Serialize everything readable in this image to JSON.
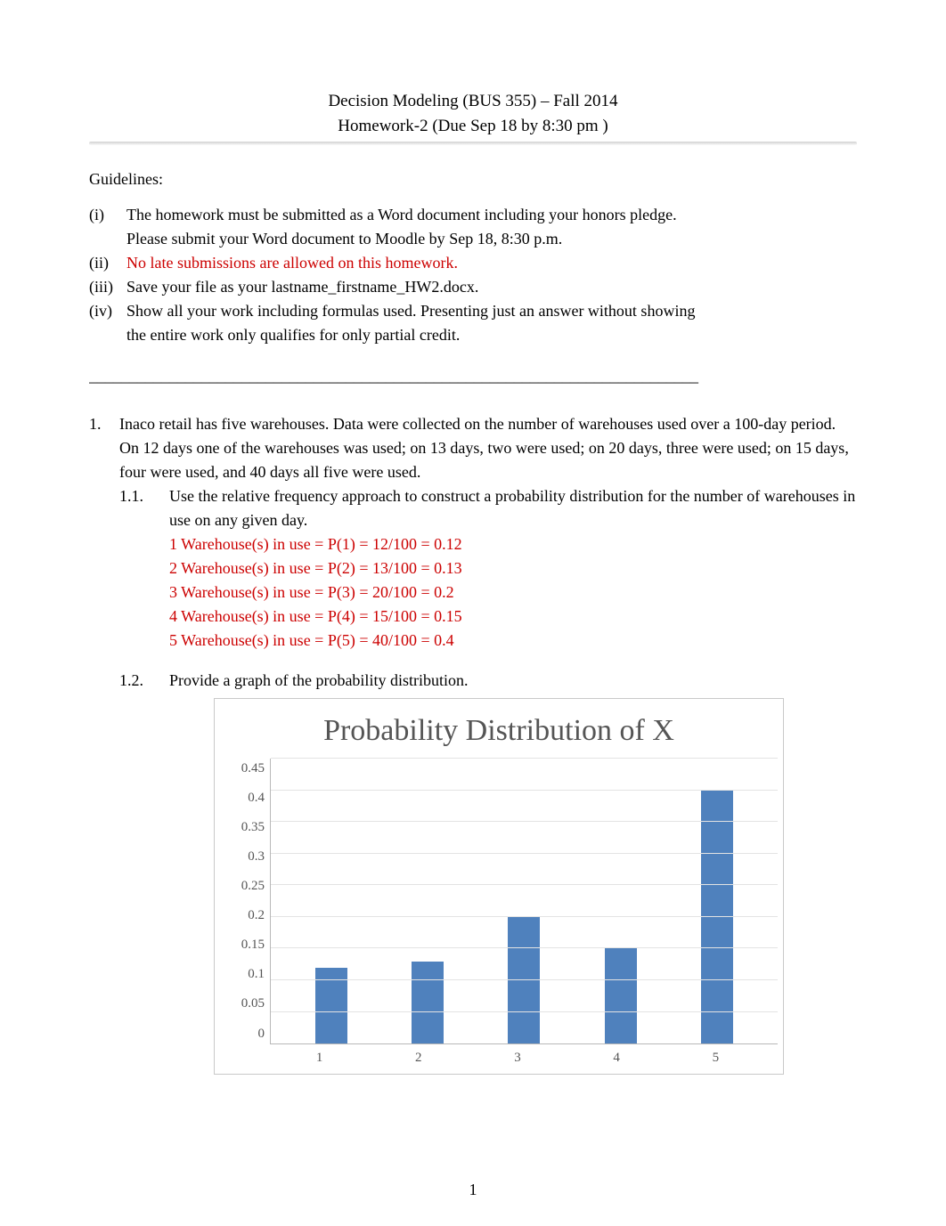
{
  "header": {
    "line1_a": "Decision Modeling (BUS 355)",
    "line1_b": "    – Fall 2014",
    "line2_a": "Homework-2 (",
    "line2_b": "Due Sep 18 by 8:30 pm",
    "line2_c": "     )"
  },
  "guidelines_label": "Guidelines:",
  "guidelines": {
    "i_num": "(i)",
    "i_a": "The homework must be submitted as a ",
    "i_b": "      Word document",
    "i_c": "     including your honors pledge.",
    "i_sub_a": "Please submit your Word document to Moodle by ",
    "i_sub_b": "       Sep 18, 8:30 p.m.",
    "ii_num": "(ii)",
    "ii_txt": "No late submissions are allowed on this homework.",
    "iii_num": "(iii)",
    "iii_txt": "Save your file as your lastname_firstname_HW2.docx.",
    "iv_num": "(iv)",
    "iv_a": "Show all your work including formulas used.",
    "iv_b": "           Presenting just an answer without showing",
    "iv_sub": "the  entire work  only qualifies for only partial credit."
  },
  "divider": "____________________________________________________________________________",
  "q1": {
    "num": "1.",
    "text": "Inaco retail has five warehouses. Data were collected on the number of warehouses used over a 100-day period. On 12 days one of the warehouses was used; on 13 days, two were used; on 20 days, three were used; on 15 days, four were used, and 40 days all five were used.",
    "p1_num": "1.1.",
    "p1_a": "Use the relative frequency approach to construct a probability distribution for the number of warehouses in use ",
    "p1_b": "     on any given day.",
    "ans": {
      "l1": "1 Warehouse(s) in use = P(1) = 12/100 = 0.12",
      "l2a": "2 Warehouse(s) in use = P(2) = 13/100 = ",
      "l2b": "         0.13",
      "l3": "3 Warehouse(s) in use = P(3) = 20/100 = 0.2",
      "l4": "4 Warehouse(s) in use = P(4) = 15/100 = 0.15",
      "l5": "5 Warehouse(s) in use = P(5) = 40/100 = 0.4"
    },
    "p2_num": "1.2.",
    "p2_txt": "Provide a graph of the probability distribution."
  },
  "chart_data": {
    "type": "bar",
    "title": "Probability Distribution of X",
    "categories": [
      "1",
      "2",
      "3",
      "4",
      "5"
    ],
    "values": [
      0.12,
      0.13,
      0.2,
      0.15,
      0.4
    ],
    "xlabel": "",
    "ylabel": "",
    "ylim": [
      0,
      0.45
    ],
    "yticks": [
      "0",
      "0.05",
      "0.1",
      "0.15",
      "0.2",
      "0.25",
      "0.3",
      "0.35",
      "0.4",
      "0.45"
    ]
  },
  "page_number": "1"
}
